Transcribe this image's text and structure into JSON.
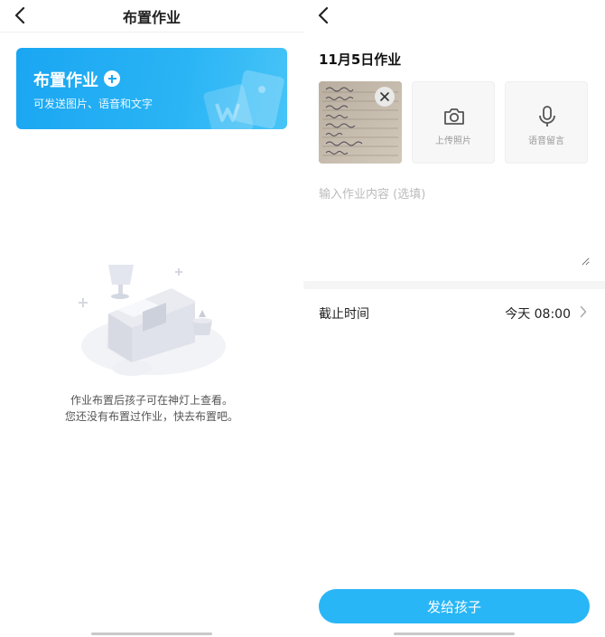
{
  "left_screen": {
    "nav": {
      "title": "布置作业",
      "back_icon": "chevron-left-icon"
    },
    "banner": {
      "title": "布置作业",
      "subtitle": "可发送图片、语音和文字",
      "plus_icon": "plus-circle-icon",
      "accent_color": "#1aa6f2"
    },
    "empty_state": {
      "line1": "作业布置后孩子可在神灯上查看。",
      "line2": "您还没有布置过作业，快去布置吧。"
    }
  },
  "right_screen": {
    "nav": {
      "back_icon": "chevron-left-icon"
    },
    "homework_date": "11月5日作业",
    "attachments": {
      "photo_thumbnail": "homework-photo",
      "remove_icon": "close-icon",
      "upload_label": "上传照片",
      "upload_icon": "camera-icon",
      "voice_label": "语音留言",
      "voice_icon": "microphone-icon"
    },
    "content_input": {
      "placeholder": "输入作业内容 (选填)",
      "value": ""
    },
    "deadline": {
      "label": "截止时间",
      "value": "今天 08:00",
      "chevron_icon": "chevron-right-icon"
    },
    "send_button": {
      "label": "发给孩子",
      "color": "#29b6f6"
    }
  }
}
